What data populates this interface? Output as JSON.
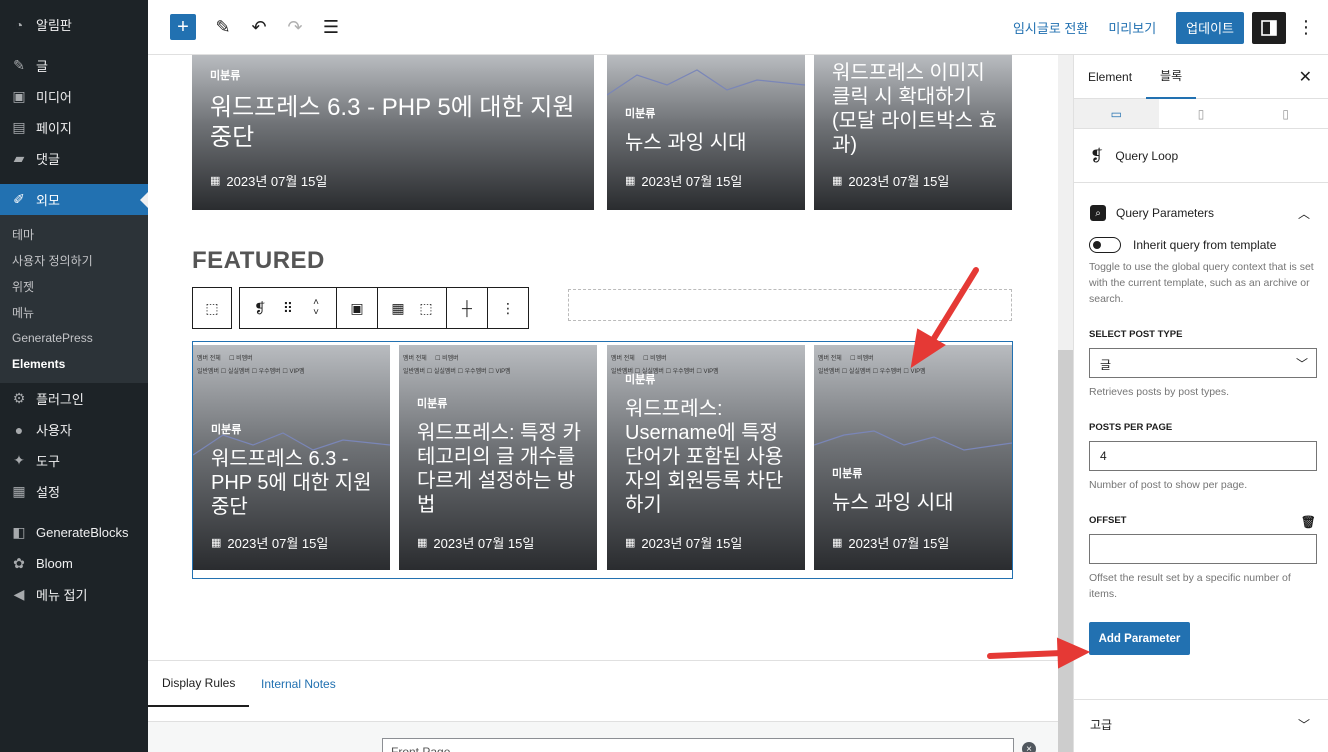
{
  "sidebar": {
    "items": [
      {
        "label": "알림판",
        "icon": "dashboard-icon"
      },
      {
        "label": "글",
        "icon": "pin-icon"
      },
      {
        "label": "미디어",
        "icon": "media-icon"
      },
      {
        "label": "페이지",
        "icon": "page-icon"
      },
      {
        "label": "댓글",
        "icon": "comment-icon"
      },
      {
        "label": "외모",
        "icon": "brush-icon"
      }
    ],
    "submenu": [
      "테마",
      "사용자 정의하기",
      "위젯",
      "메뉴",
      "GeneratePress",
      "Elements"
    ],
    "items2": [
      {
        "label": "플러그인",
        "icon": "plugin-icon"
      },
      {
        "label": "사용자",
        "icon": "user-icon"
      },
      {
        "label": "도구",
        "icon": "wrench-icon"
      },
      {
        "label": "설정",
        "icon": "settings-icon"
      },
      {
        "label": "GenerateBlocks",
        "icon": "generateblocks-icon"
      },
      {
        "label": "Bloom",
        "icon": "bloom-icon"
      },
      {
        "label": "메뉴 접기",
        "icon": "collapse-icon"
      }
    ]
  },
  "toolbar": {
    "draft": "임시글로 전환",
    "preview": "미리보기",
    "update": "업데이트"
  },
  "top_cards": [
    {
      "category": "미분류",
      "title": "워드프레스 6.3 - PHP 5에 대한 지원 중단",
      "date": "2023년 07월 15일"
    },
    {
      "category": "미분류",
      "title": "뉴스 과잉 시대",
      "date": "2023년 07월 15일"
    },
    {
      "category": "",
      "title": "워드프레스 이미지 클릭 시 확대하기 (모달 라이트박스 효과)",
      "date": "2023년 07월 15일"
    }
  ],
  "featured_heading": "FEATURED",
  "featured_cards": [
    {
      "category": "미분류",
      "title": "워드프레스 6.3 - PHP 5에 대한 지원 중단",
      "date": "2023년 07월 15일"
    },
    {
      "category": "미분류",
      "title": "워드프레스: 특정 카테고리의 글 개수를 다르게 설정하는 방법",
      "date": "2023년 07월 15일"
    },
    {
      "category": "미분류",
      "title": "워드프레스: Username에 특정 단어가 포함된 사용자의 회원등록 차단하기",
      "date": "2023년 07월 15일"
    },
    {
      "category": "미분류",
      "title": "뉴스 과잉 시대",
      "date": "2023년 07월 15일"
    }
  ],
  "mini_table": {
    "row1": [
      "멤버 전체",
      "비멤버"
    ],
    "row2": [
      "일반멤버",
      "실실멤버",
      "우수멤버",
      "VIP멤"
    ]
  },
  "metabox": {
    "tab_display": "Display Rules",
    "tab_notes": "Internal Notes",
    "select_value": "Front Page"
  },
  "panel": {
    "tab_element": "Element",
    "tab_block": "블록",
    "block_name": "Query Loop",
    "section_title": "Query Parameters",
    "inherit_label": "Inherit query from template",
    "inherit_help": "Toggle to use the global query context that is set with the current template, such as an archive or search.",
    "post_type_label": "SELECT POST TYPE",
    "post_type_value": "글",
    "post_type_help": "Retrieves posts by post types.",
    "per_page_label": "POSTS PER PAGE",
    "per_page_value": "4",
    "per_page_help": "Number of post to show per page.",
    "offset_label": "OFFSET",
    "offset_value": "",
    "offset_help": "Offset the result set by a specific number of items.",
    "add_button": "Add Parameter",
    "advanced": "고급"
  },
  "colors": {
    "accent": "#2271b1",
    "sidebar": "#1d2327",
    "annotation": "#e53935"
  }
}
